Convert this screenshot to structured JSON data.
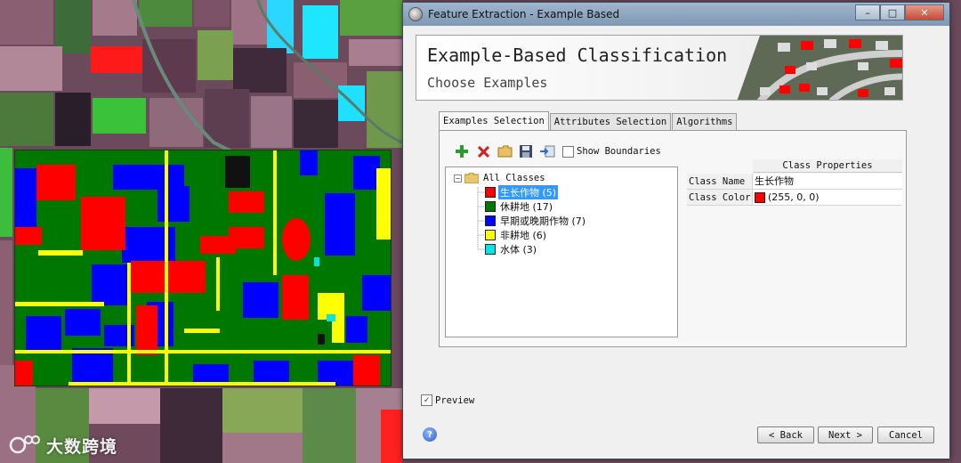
{
  "window": {
    "title": "Feature Extraction - Example Based",
    "controls": [
      "–",
      "□",
      "✕"
    ]
  },
  "banner": {
    "title": "Example-Based Classification",
    "subtitle": "Choose Examples"
  },
  "tabs": [
    {
      "label": "Examples Selection",
      "active": true
    },
    {
      "label": "Attributes Selection",
      "active": false
    },
    {
      "label": "Algorithms",
      "active": false
    }
  ],
  "toolbar": {
    "icons": [
      "add-icon",
      "delete-icon",
      "open-folder-icon",
      "save-icon",
      "import-icon"
    ],
    "show_boundaries_label": "Show Boundaries",
    "show_boundaries_checked": false
  },
  "tree": {
    "root_label": "All Classes",
    "classes": [
      {
        "label": "生长作物",
        "count": "(5)",
        "color": "#ff0000",
        "selected": true
      },
      {
        "label": "休耕地",
        "count": "(17)",
        "color": "#007800",
        "selected": false
      },
      {
        "label": "早期或晚期作物",
        "count": "(7)",
        "color": "#0000ff",
        "selected": false
      },
      {
        "label": "非耕地",
        "count": "(6)",
        "color": "#ffff00",
        "selected": false
      },
      {
        "label": "水体",
        "count": "(3)",
        "color": "#00e6e6",
        "selected": false
      }
    ]
  },
  "properties": {
    "header": "Class Properties",
    "rows": [
      {
        "key": "Class Name",
        "value": "生长作物"
      },
      {
        "key": "Class Color",
        "value": "(255, 0, 0)",
        "swatch": "#ff0000"
      }
    ]
  },
  "preview": {
    "label": "Preview",
    "checked": true
  },
  "buttons": {
    "help": "?",
    "back": "< Back",
    "next": "Next >",
    "cancel": "Cancel"
  },
  "watermark": {
    "text": "大数跨境"
  }
}
